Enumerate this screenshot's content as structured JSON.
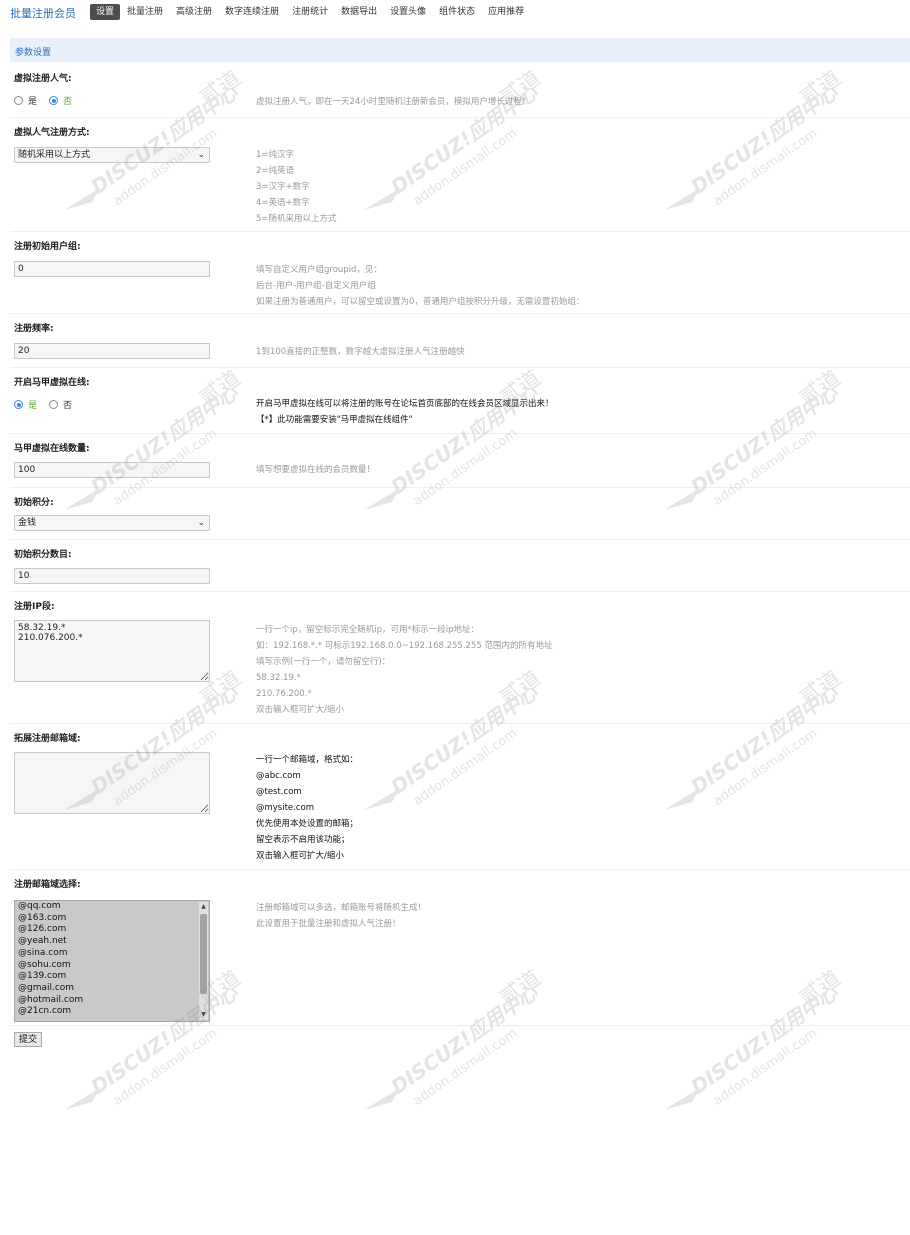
{
  "app_title": "批量注册会员",
  "nav": {
    "tabs": [
      "设置",
      "批量注册",
      "高级注册",
      "数字连续注册",
      "注册统计",
      "数据导出",
      "设置头像",
      "组件状态",
      "应用推荐"
    ],
    "active_index": 0
  },
  "section_title": "参数设置",
  "fields": {
    "virtual_popularity": {
      "label": "虚拟注册人气:",
      "options": [
        "是",
        "否"
      ],
      "selected": "否",
      "desc": [
        "虚拟注册人气，即在一天24小时里随机注册新会员，模拟用户增长过程！"
      ]
    },
    "virtual_method": {
      "label": "虚拟人气注册方式:",
      "value": "随机采用以上方式",
      "desc": [
        "1=纯汉字",
        "2=纯英语",
        "3=汉字+数字",
        "4=英语+数字",
        "5=随机采用以上方式"
      ]
    },
    "initial_group": {
      "label": "注册初始用户组:",
      "value": "0",
      "desc": [
        "填写自定义用户组groupid，见：",
        "后台-用户-用户组-自定义用户组",
        "如果注册为普通用户，可以留空或设置为0，普通用户组按积分升级，无需设置初始组："
      ]
    },
    "frequency": {
      "label": "注册频率:",
      "value": "20",
      "desc": [
        "1到100直接的正整数，数字越大虚拟注册人气注册越快"
      ]
    },
    "vest_online": {
      "label": "开启马甲虚拟在线:",
      "options": [
        "是",
        "否"
      ],
      "selected": "是",
      "desc": [
        "开启马甲虚拟在线可以将注册的账号在论坛首页底部的在线会员区域显示出来！",
        "【*】此功能需要安装\"马甲虚拟在线组件\""
      ]
    },
    "vest_online_count": {
      "label": "马甲虚拟在线数量:",
      "value": "100",
      "desc": [
        "填写想要虚拟在线的会员数量！"
      ]
    },
    "initial_credit": {
      "label": "初始积分:",
      "value": "金钱"
    },
    "initial_credit_amount": {
      "label": "初始积分数目:",
      "value": "10"
    },
    "ip_range": {
      "label": "注册IP段:",
      "value": "58.32.19.*\n210.076.200.*",
      "desc": [
        "一行一个ip，留空标示完全随机ip，可用*标示一段ip地址：",
        "如：192.168.*.* 可标示192.168.0.0~192.168.255.255 范围内的所有地址",
        "填写示例(一行一个，请勿留空行)：",
        "58.32.19.*",
        "210.76.200.*",
        "双击输入框可扩大/缩小"
      ]
    },
    "extra_email_domains": {
      "label": "拓展注册邮箱域:",
      "value": "",
      "desc": [
        "一行一个邮箱域，格式如：",
        "@abc.com",
        "@test.com",
        "@mysite.com",
        "优先使用本处设置的邮箱；",
        "留空表示不启用该功能；",
        "双击输入框可扩大/缩小"
      ]
    },
    "email_domain_select": {
      "label": "注册邮箱域选择:",
      "items": [
        "@qq.com",
        "@163.com",
        "@126.com",
        "@yeah.net",
        "@sina.com",
        "@sohu.com",
        "@139.com",
        "@gmail.com",
        "@hotmail.com",
        "@21cn.com"
      ],
      "desc": [
        "注册邮箱域可以多选，邮箱账号将随机生成！",
        "此设置用于批量注册和虚拟人气注册！"
      ]
    }
  },
  "submit_label": "提交",
  "watermark": {
    "brand": "DISCUZ!应用中心",
    "url": "addon.dismall.com",
    "mark": "贰道"
  }
}
